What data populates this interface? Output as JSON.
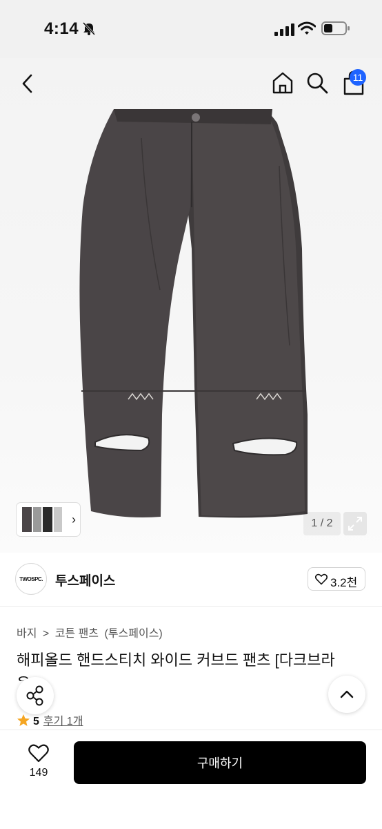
{
  "status_bar": {
    "time": "4:14",
    "battery_level": 0.35
  },
  "header": {
    "back_icon": "chevron-left-icon",
    "home_icon": "home-icon",
    "search_icon": "search-icon",
    "cart_icon": "shopping-bag-icon",
    "cart_count": "11",
    "badge_color": "#1e63ff"
  },
  "gallery": {
    "counter": "1 / 2",
    "expand_icon": "expand-icon"
  },
  "shop": {
    "logo_text": "TWOSPC.",
    "name": "투스페이스",
    "like_count": "3.2천"
  },
  "breadcrumb": [
    "바지",
    ">",
    "코튼 팬츠",
    "(투스페이스)"
  ],
  "product": {
    "title_line1": "해피올드 핸드스티치 와이드 커브드 팬츠 [다크브라",
    "title_line2": "운]",
    "rating": "5",
    "reviews": "후기 1개"
  },
  "actions": {
    "wish_count": "149",
    "buy_label": "구매하기"
  }
}
